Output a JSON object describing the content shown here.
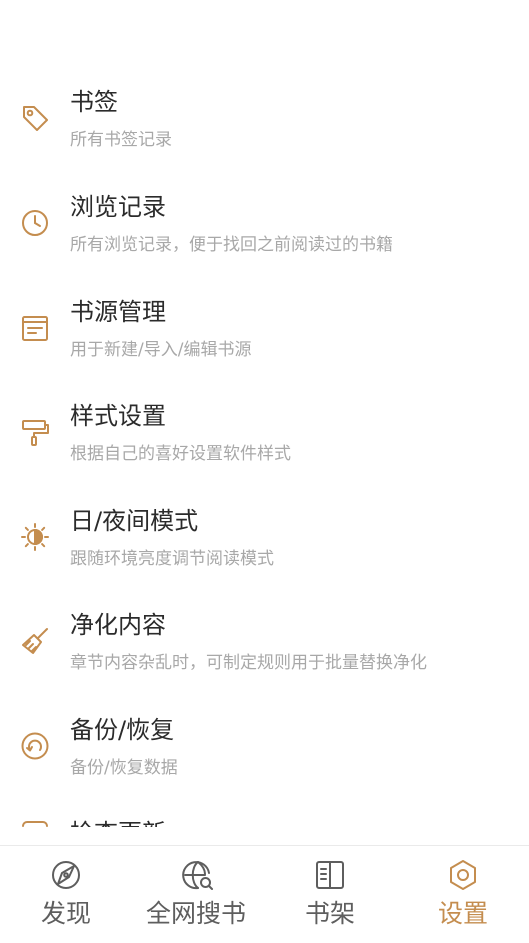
{
  "colors": {
    "accent": "#c48d4f",
    "title_text": "#2b2b2b",
    "subtitle_text": "#a8a8a8",
    "nav_inactive": "#5e5e5e"
  },
  "settings": [
    {
      "icon": "tag-icon",
      "title": "书签",
      "subtitle": "所有书签记录"
    },
    {
      "icon": "clock-icon",
      "title": "浏览记录",
      "subtitle": "所有浏览记录，便于找回之前阅读过的书籍"
    },
    {
      "icon": "book-source-icon",
      "title": "书源管理",
      "subtitle": "用于新建/导入/编辑书源"
    },
    {
      "icon": "paint-roller-icon",
      "title": "样式设置",
      "subtitle": "根据自己的喜好设置软件样式"
    },
    {
      "icon": "day-night-icon",
      "title": "日/夜间模式",
      "subtitle": "跟随环境亮度调节阅读模式"
    },
    {
      "icon": "broom-icon",
      "title": "净化内容",
      "subtitle": "章节内容杂乱时，可制定规则用于批量替换净化"
    },
    {
      "icon": "backup-restore-icon",
      "title": "备份/恢复",
      "subtitle": "备份/恢复数据"
    },
    {
      "icon": "upload-icon",
      "title": "检查更新",
      "subtitle": ""
    }
  ],
  "nav": [
    {
      "icon": "compass-icon",
      "label": "发现",
      "active": false
    },
    {
      "icon": "globe-search-icon",
      "label": "全网搜书",
      "active": false
    },
    {
      "icon": "bookshelf-icon",
      "label": "书架",
      "active": false
    },
    {
      "icon": "gear-icon",
      "label": "设置",
      "active": true
    }
  ]
}
